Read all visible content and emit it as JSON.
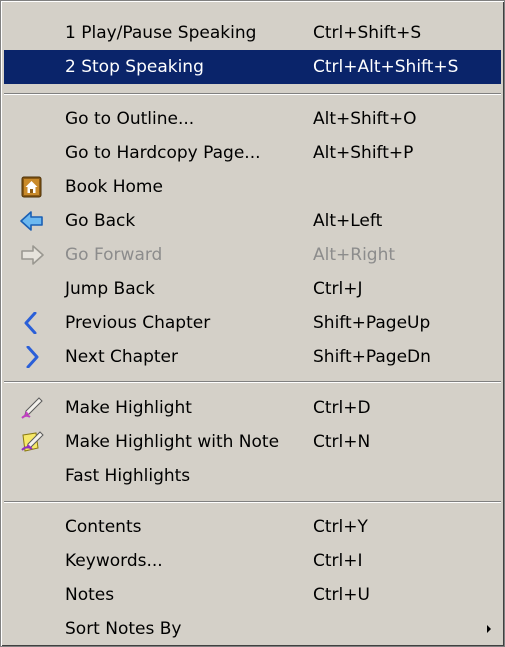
{
  "menu": {
    "items": [
      {
        "label": "1 Play/Pause Speaking",
        "shortcut": "Ctrl+Shift+S"
      },
      {
        "label": "2 Stop Speaking",
        "shortcut": "Ctrl+Alt+Shift+S"
      },
      {
        "label": "Go to Outline...",
        "shortcut": "Alt+Shift+O"
      },
      {
        "label": "Go to Hardcopy Page...",
        "shortcut": "Alt+Shift+P"
      },
      {
        "label": "Book Home",
        "shortcut": "",
        "icon": "book-home-icon"
      },
      {
        "label": "Go Back",
        "shortcut": "Alt+Left",
        "icon": "back-arrow-icon"
      },
      {
        "label": "Go Forward",
        "shortcut": "Alt+Right",
        "icon": "forward-arrow-icon"
      },
      {
        "label": "Jump Back",
        "shortcut": "Ctrl+J"
      },
      {
        "label": "Previous Chapter",
        "shortcut": "Shift+PageUp",
        "icon": "chevron-left-icon"
      },
      {
        "label": "Next Chapter",
        "shortcut": "Shift+PageDn",
        "icon": "chevron-right-icon"
      },
      {
        "label": "Make Highlight",
        "shortcut": "Ctrl+D",
        "icon": "highlighter-pen-icon"
      },
      {
        "label": "Make Highlight with Note",
        "shortcut": "Ctrl+N",
        "icon": "highlight-note-icon"
      },
      {
        "label": "Fast Highlights",
        "shortcut": ""
      },
      {
        "label": "Contents",
        "shortcut": "Ctrl+Y"
      },
      {
        "label": "Keywords...",
        "shortcut": "Ctrl+I"
      },
      {
        "label": "Notes",
        "shortcut": "Ctrl+U"
      },
      {
        "label": "Sort Notes By",
        "shortcut": "",
        "submenu_icon": "submenu-arrow-icon"
      }
    ],
    "selected_item": "2 Stop Speaking",
    "disabled_items": [
      "Go Forward"
    ],
    "colors": {
      "background": "#d4d0c8",
      "selection": "#0a246a",
      "selection_text": "#ffffff",
      "disabled_text": "#8c8c8c"
    }
  }
}
